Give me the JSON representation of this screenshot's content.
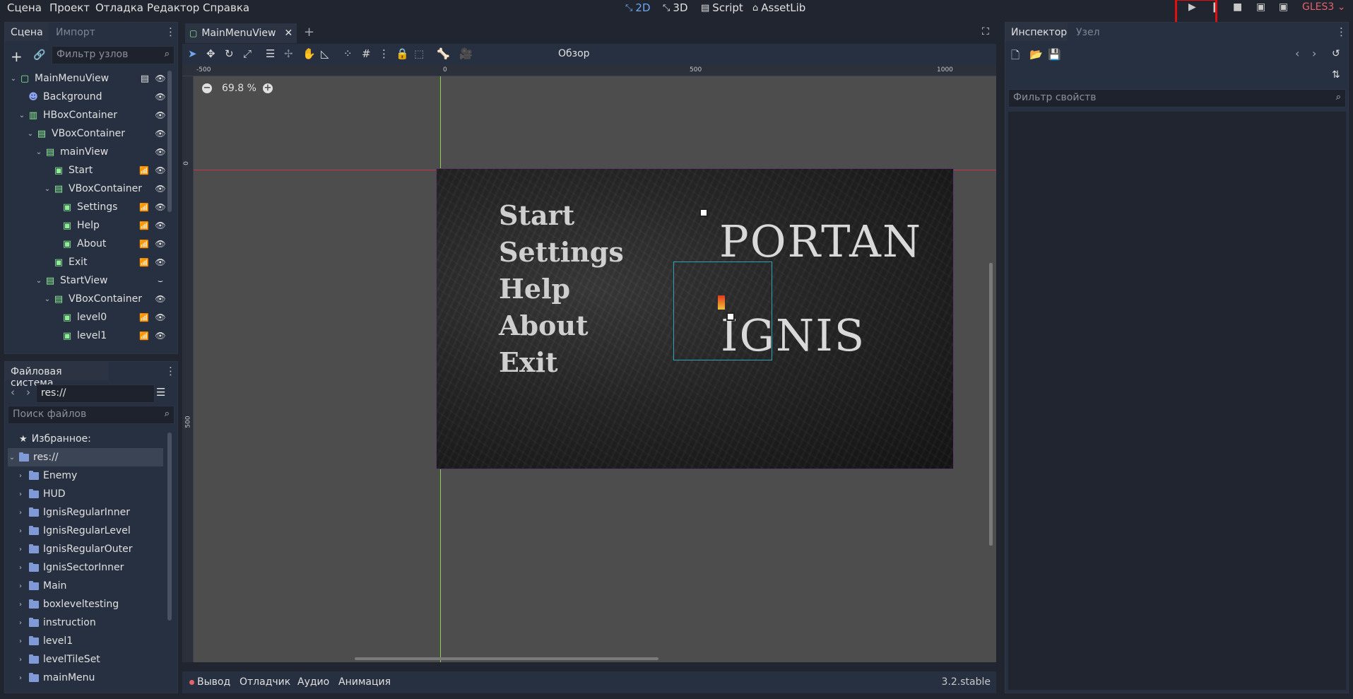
{
  "menu": [
    "Сцена",
    "Проект",
    "Отладка",
    "Редактор",
    "Справка"
  ],
  "workspaces": [
    {
      "label": "2D",
      "icon": "2d-icon",
      "active": true
    },
    {
      "label": "3D",
      "icon": "3d-icon",
      "active": false
    },
    {
      "label": "Script",
      "icon": "script-icon",
      "active": false
    },
    {
      "label": "AssetLib",
      "icon": "assetlib-icon",
      "active": false
    }
  ],
  "renderer": "GLES3",
  "scene_dock": {
    "tabs": [
      "Сцена",
      "Импорт"
    ],
    "filter_placeholder": "Фильтр узлов",
    "nodes": [
      {
        "label": "MainMenuView",
        "depth": 0,
        "type": "control",
        "script": true
      },
      {
        "label": "Background",
        "depth": 1,
        "type": "sprite"
      },
      {
        "label": "HBoxContainer",
        "depth": 1,
        "type": "hbox"
      },
      {
        "label": "VBoxContainer",
        "depth": 2,
        "type": "vbox"
      },
      {
        "label": "mainView",
        "depth": 3,
        "type": "vbox"
      },
      {
        "label": "Start",
        "depth": 4,
        "type": "button",
        "signal": true
      },
      {
        "label": "VBoxContainer",
        "depth": 4,
        "type": "vbox"
      },
      {
        "label": "Settings",
        "depth": 5,
        "type": "button",
        "signal": true
      },
      {
        "label": "Help",
        "depth": 5,
        "type": "button",
        "signal": true
      },
      {
        "label": "About",
        "depth": 5,
        "type": "button",
        "signal": true
      },
      {
        "label": "Exit",
        "depth": 4,
        "type": "button",
        "signal": true
      },
      {
        "label": "StartView",
        "depth": 3,
        "type": "vbox",
        "hidden": true
      },
      {
        "label": "VBoxContainer",
        "depth": 4,
        "type": "vbox"
      },
      {
        "label": "level0",
        "depth": 5,
        "type": "button",
        "signal": true
      },
      {
        "label": "level1",
        "depth": 5,
        "type": "button",
        "signal": true
      }
    ]
  },
  "fs_dock": {
    "title": "Файловая система",
    "path": "res://",
    "search_placeholder": "Поиск файлов",
    "favorites": "Избранное:",
    "root": "res://",
    "folders": [
      "Enemy",
      "HUD",
      "IgnisRegularInner",
      "IgnisRegularLevel",
      "IgnisRegularOuter",
      "IgnisSectorInner",
      "Main",
      "boxleveltesting",
      "instruction",
      "level1",
      "levelTileSet",
      "mainMenu"
    ]
  },
  "editor": {
    "tab": "MainMenuView",
    "zoom": "69.8 %",
    "overview": "Обзор",
    "ruler_h": [
      "-500",
      "0",
      "500",
      "1000"
    ],
    "ruler_v": [
      "0",
      "500"
    ],
    "scene_menu": [
      "Start",
      "Settings",
      "Help",
      "About",
      "Exit"
    ],
    "logo_line1": "PORTAN",
    "logo_line2": "IGNIS"
  },
  "inspector": {
    "tabs": [
      "Инспектор",
      "Узел"
    ],
    "filter_placeholder": "Фильтр свойств"
  },
  "bottom": {
    "items": [
      "Вывод",
      "Отладчик",
      "Аудио",
      "Анимация"
    ],
    "version": "3.2.stable"
  },
  "colors": {
    "accent": "#6fa8f0",
    "highlight_box": "#e01010",
    "node_green": "#8eef97",
    "folder": "#7f9ad6"
  }
}
